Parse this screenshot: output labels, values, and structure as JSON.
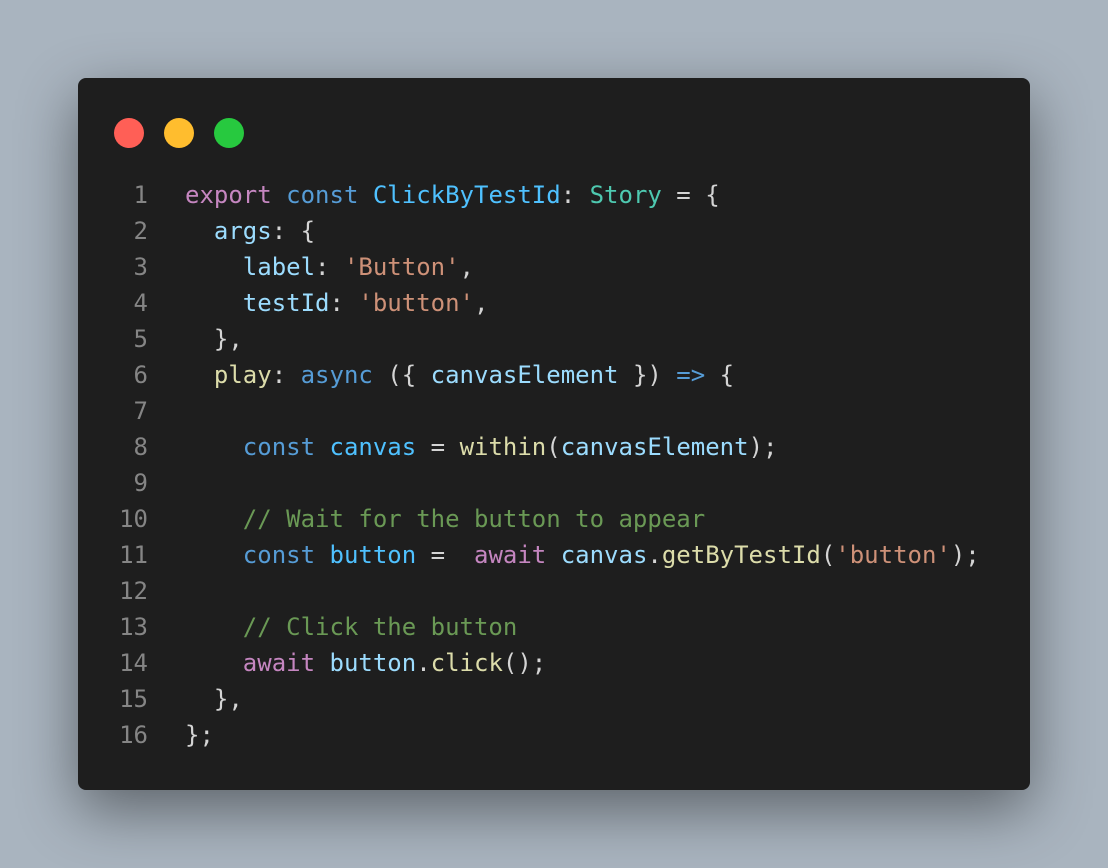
{
  "window": {
    "controls": [
      "close",
      "minimize",
      "maximize"
    ]
  },
  "colors": {
    "background": "#1e1e1e",
    "close": "#ff5f56",
    "minimize": "#ffbd2e",
    "maximize": "#27c93f"
  },
  "code": {
    "language": "typescript",
    "lines": [
      {
        "num": "1",
        "tokens": [
          [
            "export",
            "kw2"
          ],
          [
            " ",
            "p"
          ],
          [
            "const",
            "kw"
          ],
          [
            " ",
            "p"
          ],
          [
            "ClickByTestId",
            "const"
          ],
          [
            ": ",
            "p"
          ],
          [
            "Story",
            "type"
          ],
          [
            " = {",
            "p"
          ]
        ]
      },
      {
        "num": "2",
        "tokens": [
          [
            "  ",
            "p"
          ],
          [
            "args",
            "prop"
          ],
          [
            ": {",
            "p"
          ]
        ]
      },
      {
        "num": "3",
        "tokens": [
          [
            "    ",
            "p"
          ],
          [
            "label",
            "prop"
          ],
          [
            ": ",
            "p"
          ],
          [
            "'Button'",
            "str"
          ],
          [
            ",",
            "p"
          ]
        ]
      },
      {
        "num": "4",
        "tokens": [
          [
            "    ",
            "p"
          ],
          [
            "testId",
            "prop"
          ],
          [
            ": ",
            "p"
          ],
          [
            "'button'",
            "str"
          ],
          [
            ",",
            "p"
          ]
        ]
      },
      {
        "num": "5",
        "tokens": [
          [
            "  },",
            "p"
          ]
        ]
      },
      {
        "num": "6",
        "tokens": [
          [
            "  ",
            "p"
          ],
          [
            "play",
            "fn"
          ],
          [
            ": ",
            "p"
          ],
          [
            "async",
            "kw"
          ],
          [
            " ({ ",
            "p"
          ],
          [
            "canvasElement",
            "prop"
          ],
          [
            " }) ",
            "p"
          ],
          [
            "=>",
            "kw"
          ],
          [
            " {",
            "p"
          ]
        ]
      },
      {
        "num": "7",
        "tokens": []
      },
      {
        "num": "8",
        "tokens": [
          [
            "    ",
            "p"
          ],
          [
            "const",
            "kw"
          ],
          [
            " ",
            "p"
          ],
          [
            "canvas",
            "const"
          ],
          [
            " = ",
            "p"
          ],
          [
            "within",
            "fn"
          ],
          [
            "(",
            "p"
          ],
          [
            "canvasElement",
            "prop"
          ],
          [
            ");",
            "p"
          ]
        ]
      },
      {
        "num": "9",
        "tokens": []
      },
      {
        "num": "10",
        "tokens": [
          [
            "    ",
            "p"
          ],
          [
            "// Wait for the button to appear",
            "cm"
          ]
        ]
      },
      {
        "num": "11",
        "tokens": [
          [
            "    ",
            "p"
          ],
          [
            "const",
            "kw"
          ],
          [
            " ",
            "p"
          ],
          [
            "button",
            "const"
          ],
          [
            " =  ",
            "p"
          ],
          [
            "await",
            "kw2"
          ],
          [
            " ",
            "p"
          ],
          [
            "canvas",
            "prop"
          ],
          [
            ".",
            "p"
          ],
          [
            "getByTestId",
            "fn"
          ],
          [
            "(",
            "p"
          ],
          [
            "'button'",
            "str"
          ],
          [
            ");",
            "p"
          ]
        ]
      },
      {
        "num": "12",
        "tokens": []
      },
      {
        "num": "13",
        "tokens": [
          [
            "    ",
            "p"
          ],
          [
            "// Click the button",
            "cm"
          ]
        ]
      },
      {
        "num": "14",
        "tokens": [
          [
            "    ",
            "p"
          ],
          [
            "await",
            "kw2"
          ],
          [
            " ",
            "p"
          ],
          [
            "button",
            "prop"
          ],
          [
            ".",
            "p"
          ],
          [
            "click",
            "fn"
          ],
          [
            "();",
            "p"
          ]
        ]
      },
      {
        "num": "15",
        "tokens": [
          [
            "  },",
            "p"
          ]
        ]
      },
      {
        "num": "16",
        "tokens": [
          [
            "};",
            "p"
          ]
        ]
      }
    ]
  }
}
